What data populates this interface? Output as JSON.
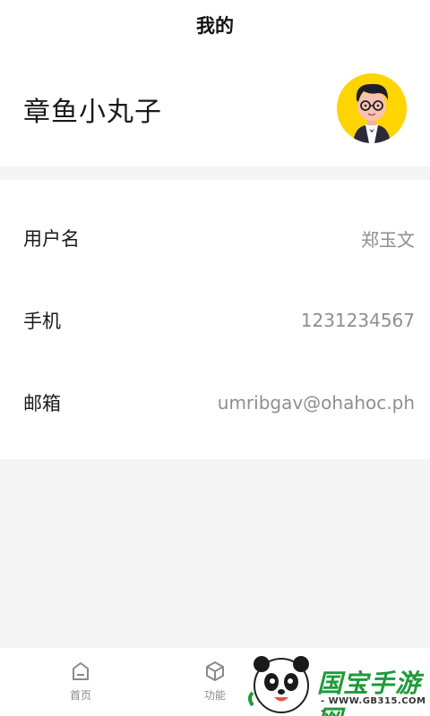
{
  "header": {
    "title": "我的"
  },
  "profile": {
    "name": "章鱼小丸子"
  },
  "info": {
    "rows": [
      {
        "label": "用户名",
        "value": "郑玉文"
      },
      {
        "label": "手机",
        "value": "1231234567"
      },
      {
        "label": "邮箱",
        "value": "umribgav@ohahoc.ph"
      }
    ]
  },
  "tabbar": {
    "tabs": [
      {
        "label": "首页",
        "icon": "home-icon"
      },
      {
        "label": "功能",
        "icon": "cube-icon"
      }
    ]
  },
  "watermark": {
    "main": "国宝手游网",
    "sub": "- WWW.GB315.COM -"
  },
  "colors": {
    "avatar_bg": "#ffd400",
    "watermark_green": "#1f9a3b"
  }
}
